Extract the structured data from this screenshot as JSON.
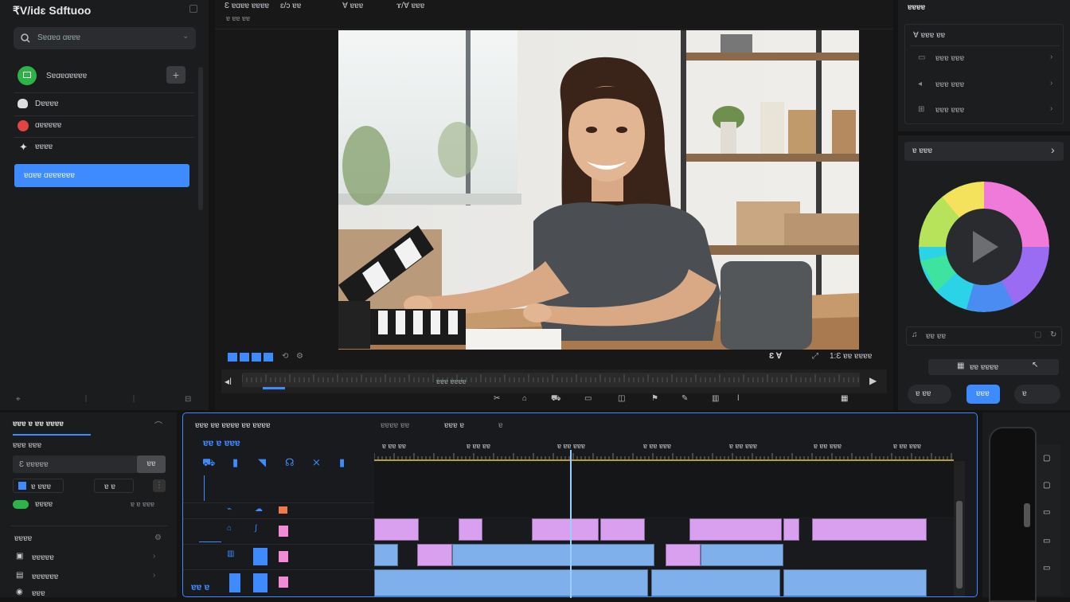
{
  "app": {
    "title": "₹V/idɛ Sdftuoo"
  },
  "sidebar": {
    "search_placeholder": "Sɐɑɐɑ ɑɐɐɐ",
    "items": [
      {
        "label": "Sɐɑɐɑɐɐɐɐ",
        "icon": "add-media-icon"
      },
      {
        "label": "Dɐɐɐɐ",
        "icon": "cloud-icon"
      },
      {
        "label": "ɑɐɐɐɐɐ",
        "icon": "record-icon"
      },
      {
        "label": "ɐɐɐɐ",
        "icon": "wand-icon"
      }
    ],
    "active_label": "ɐɑɐɐ ɑɐɐɐɐɐɐ"
  },
  "viewer": {
    "menu": [
      "Ɛ ɐɑɐɐ ɐɐɐɐ",
      "ɛ/ɔ ɐɐ",
      "Ɐ ɐɐɐ",
      "ɤ/Ɐ ɐɐɐ"
    ],
    "submenu": "ɐ ɐɐ ɐɐ",
    "counter": "Ɛ Ɐ",
    "timecode_right": "1:Ɛ ɐɐ ɐɐɐɐ",
    "scrub_label": "ɐɐɐ ɐɐɐɐ",
    "image_alt": "Smiling woman sitting at a desk with a film clapperboard"
  },
  "inspector": {
    "title": "ɐɐɐɐ",
    "section_title": "Ɐ ɐɐɐ ɐɐ",
    "items": [
      "ɐɐɐ ɐɐɐ",
      "ɐɐɐ ɐɐɐ",
      "ɐɐɐ ɐɐɐ"
    ],
    "color_title": "ɐ ɐɐɐ",
    "search_label": "ɐɐ ɐɐ",
    "field_value": "ɐɐ ɐɐɐɐ",
    "btn_back": "ɐ ɐɐ",
    "btn_apply": "ɐɐɐ",
    "btn_right": "ɐ"
  },
  "left_bottom": {
    "tab_title": "ɐɐɐ ɐ ɐɐ ɐɐɐɐ",
    "subtitle": "ɐɐɐ ɐɐɐ",
    "input_value": "Ɛ ɐɐɐɐɐ",
    "dropdown_value": "ɐɐ",
    "chip1": "ɐ ɐɐɐ",
    "chip2": "ɐ ɐ",
    "toggle_label": "ɐɐɐɐ",
    "toggle_value": "ɐ ɐ ɐɐɐ",
    "section2": "ɐɐɐɐ",
    "rows": [
      "ɐɐɐɐɐ",
      "ɐɐɐɐɐɐ",
      "ɐɐɐ"
    ]
  },
  "timeline": {
    "header": "ɐɐɐ ɐɐ ɐɐɐɐ ɐɐ ɐɐɐɐ",
    "tools_label": "ɐɐ ɐ ɐɐɐ",
    "tabs": [
      "ɐɐɐɐ ɐɐ",
      "ɐɐɐ ɐ",
      "ɐ"
    ],
    "ruler": [
      "ɐ ɐɐ ɐɐ",
      "ɐ ɐɐ ɐɐ",
      "ɐ ɐɐ ɐɐɐ",
      "ɐ ɐɐ ɐɐɐ",
      "ɐ ɐɐ ɐɐɐ",
      "ɐ ɐɐ ɐɐɐ",
      "ɐ ɐɐ ɐɐɐ"
    ],
    "track_labels": [
      "ɐ",
      "ɐ",
      "ɐ ɐ"
    ],
    "timecode": "ɐɐ ɐ"
  },
  "colors": {
    "accent": "#3d8bff",
    "pink_clip": "#d9a0f0",
    "blue_clip": "#7fb0ec",
    "panel": "#1e1f21",
    "bg": "#141414"
  }
}
